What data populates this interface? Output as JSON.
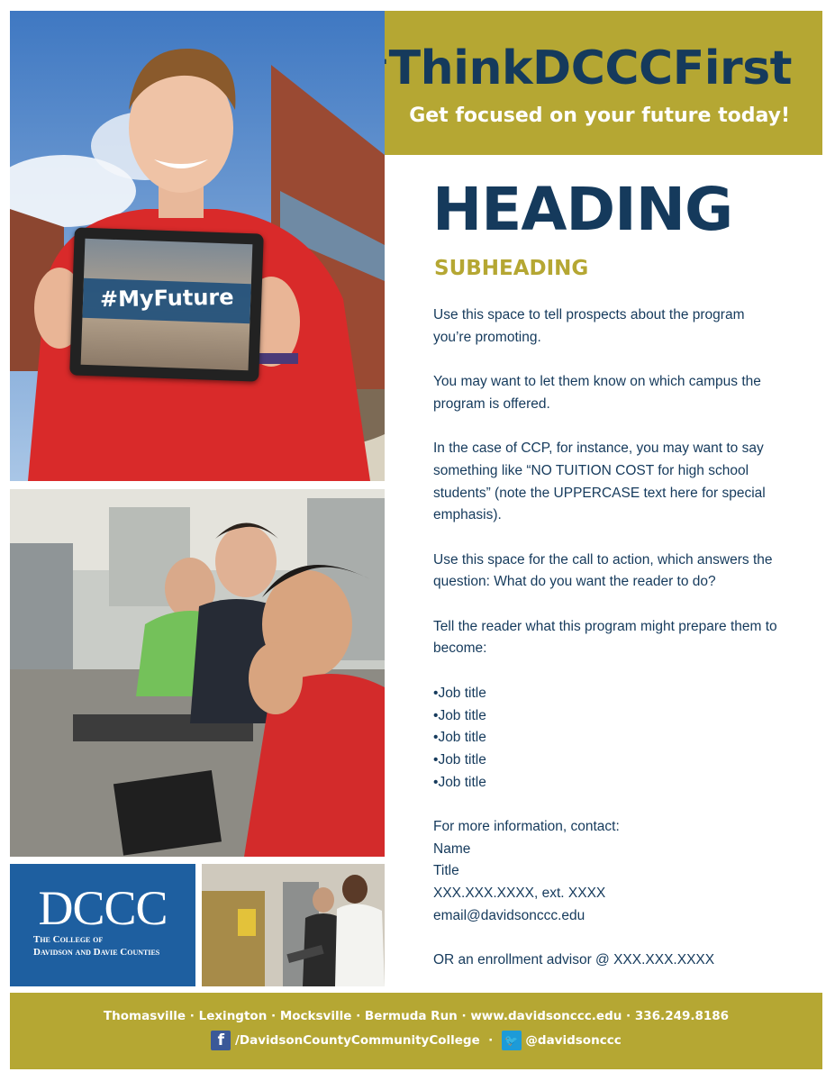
{
  "banner": {
    "hashtag": "#ThinkDCCCFirst",
    "tagline": "Get focused on your future today!"
  },
  "photo_top": {
    "tablet_text": "#MyFuture"
  },
  "logo": {
    "mark": "DCCC",
    "line1": "The College of",
    "line2": "Davidson and Davie Counties"
  },
  "content": {
    "heading": "HEADING",
    "subheading": "SUBHEADING",
    "paragraphs": [
      "Use this space to tell prospects about the program you’re promoting.",
      "You may want to let them know on which campus the program is offered.",
      "In the case of CCP, for instance, you may want to say something like “NO TUITION COST for high school students” (note the UPPERCASE text here for special emphasis).",
      "Use this space for the call to action, which answers the question: What do you want the reader to do?",
      "Tell the reader what this program might prepare them to become:"
    ],
    "jobs": [
      "Job title",
      "Job title",
      "Job title",
      "Job title",
      "Job title"
    ],
    "contact": {
      "intro": "For more information, contact:",
      "name": "Name",
      "title": "Title",
      "phone": "XXX.XXX.XXXX, ext. XXXX",
      "email": "email@davidsonccc.edu"
    },
    "advisor": "OR an enrollment advisor @ XXX.XXX.XXXX"
  },
  "footer": {
    "locations": "Thomasville · Lexington · Mocksville · Bermuda Run · www.davidsonccc.edu · 336.249.8186",
    "facebook": "/DavidsonCountyCommunityCollege",
    "separator": "·",
    "twitter": "@davidsonccc"
  },
  "colors": {
    "gold": "#b5a733",
    "navy": "#153a5c",
    "logo_blue": "#1e5fa0"
  }
}
